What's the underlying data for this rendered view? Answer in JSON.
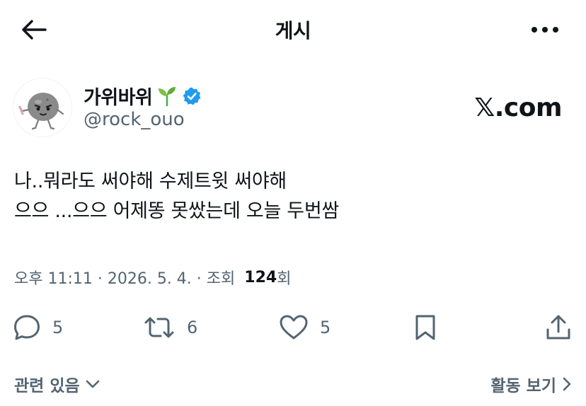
{
  "header": {
    "title": "게시",
    "back_icon": "back-arrow-icon",
    "more_icon": "more-dots-icon"
  },
  "author": {
    "display_name": "가위바위",
    "handle": "@rock_ouo",
    "verified": true,
    "verified_color": "#1d9bf0",
    "watermark": "𝕏.com"
  },
  "tweet": {
    "lines": [
      "나..뭐라도 써야해 수제트윗 써야해",
      "으으 ...으으 어제똥 못쌌는데 오늘 두번쌈"
    ]
  },
  "meta": {
    "prefix": "오후 11:11 · 2026. 5. 4. · 조회 ",
    "views": "124",
    "views_suffix": "회"
  },
  "actions": {
    "replies": "5",
    "reposts": "6",
    "likes": "5"
  },
  "footer": {
    "related_label": "관련 있음",
    "activity_label": "활동 보기"
  },
  "colors": {
    "text": "#0f1419",
    "secondary": "#536471",
    "accent": "#1d9bf0"
  }
}
